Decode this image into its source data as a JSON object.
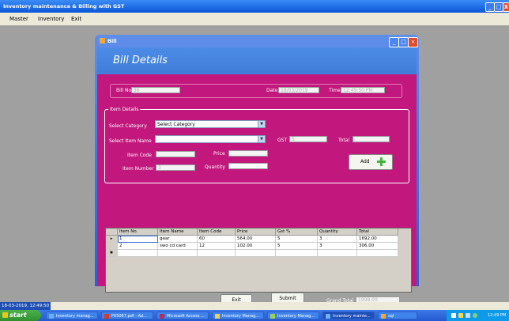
{
  "window": {
    "title": "Inventory maintenance & Billing with GST",
    "controls": [
      "_",
      "□",
      "X"
    ]
  },
  "menu": {
    "items": [
      "Master",
      "Inventory",
      "Exit"
    ]
  },
  "bill_frame": {
    "title": "Bill",
    "heading": "Bill Details"
  },
  "bill_info": {
    "bill_no_label": "Bill No.",
    "bill_no_value": "36",
    "date_label": "Date",
    "date_value": "18/03/2019",
    "time_label": "Time",
    "time_value": "12:49:50 PM"
  },
  "item_details": {
    "group_title": "Item Details",
    "category_label": "Select Category",
    "category_value": "Select Category",
    "item_name_label": "Select Item Name",
    "item_name_value": "",
    "gst_label": "GST",
    "gst_value": "5",
    "total_label": "Total",
    "total_value": "",
    "item_code_label": "Item Code",
    "item_code_value": "",
    "price_label": "Price",
    "price_value": "",
    "item_number_label": "Item Number",
    "item_number_value": "3",
    "quantity_label": "Quantity",
    "quantity_value": "",
    "add_button": "Add"
  },
  "table": {
    "columns": [
      "Item No.",
      "Item Name",
      "Item Code",
      "Price",
      "Gst %",
      "Quantity",
      "Total"
    ],
    "rows": [
      [
        "1",
        "gear",
        "60",
        "564.00",
        "5",
        "3",
        "1692.00"
      ],
      [
        "2",
        "swo cd card",
        "12",
        "102.00",
        "5",
        "3",
        "306.00"
      ]
    ],
    "row_markers": [
      "▸",
      "",
      "✱"
    ]
  },
  "footer": {
    "exit_button": "Exit",
    "submit_button": "Submit",
    "grand_total_label": "Grand Total",
    "grand_total_value": "1998.00"
  },
  "status_bar": {
    "text": "18-03-2019, 12:49:50"
  },
  "taskbar": {
    "start_label": "start",
    "tasks": [
      "Inventory manag...",
      "P05067.pdf - Ad...",
      "Microsoft Access ...",
      "Inventory Manag...",
      "Inventory Manag...",
      "Inventory mainte...",
      "sql"
    ],
    "clock": "12:49 PM"
  },
  "colors": {
    "panel": "#c2187d",
    "title_blue": "#245ad0",
    "desktop": "#a0a0a0"
  }
}
